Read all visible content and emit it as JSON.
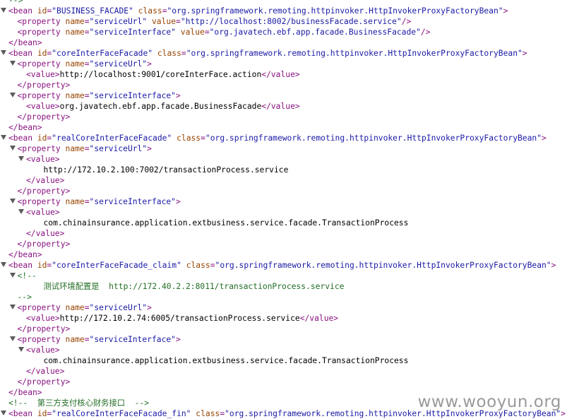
{
  "xml_viewer": {
    "lines": [
      {
        "indent": 0,
        "toggle": false,
        "parts": [
          [
            "cmt",
            "-->"
          ]
        ]
      },
      {
        "indent": 0,
        "toggle": true,
        "parts": [
          [
            "tag",
            "<bean "
          ],
          [
            "attr",
            "id"
          ],
          [
            "tag",
            "="
          ],
          [
            "val",
            "\"BUSINESS_FACADE\""
          ],
          [
            "tag",
            " "
          ],
          [
            "attr",
            "class"
          ],
          [
            "tag",
            "="
          ],
          [
            "val",
            "\"org.springframework.remoting.httpinvoker.HttpInvokerProxyFactoryBean\""
          ],
          [
            "tag",
            ">"
          ]
        ]
      },
      {
        "indent": 1,
        "toggle": false,
        "parts": [
          [
            "tag",
            "<property "
          ],
          [
            "attr",
            "name"
          ],
          [
            "tag",
            "="
          ],
          [
            "val",
            "\"serviceUrl\""
          ],
          [
            "tag",
            " "
          ],
          [
            "attr",
            "value"
          ],
          [
            "tag",
            "="
          ],
          [
            "val",
            "\"http://localhost:8002/businessFacade.service\""
          ],
          [
            "tag",
            "/>"
          ]
        ]
      },
      {
        "indent": 1,
        "toggle": false,
        "parts": [
          [
            "tag",
            "<property "
          ],
          [
            "attr",
            "name"
          ],
          [
            "tag",
            "="
          ],
          [
            "val",
            "\"serviceInterface\""
          ],
          [
            "tag",
            " "
          ],
          [
            "attr",
            "value"
          ],
          [
            "tag",
            "="
          ],
          [
            "val",
            "\"org.javatech.ebf.app.facade.BusinessFacade\""
          ],
          [
            "tag",
            "/>"
          ]
        ]
      },
      {
        "indent": 0,
        "toggle": false,
        "parts": [
          [
            "tag",
            "</bean>"
          ]
        ]
      },
      {
        "indent": 0,
        "toggle": true,
        "parts": [
          [
            "tag",
            "<bean "
          ],
          [
            "attr",
            "id"
          ],
          [
            "tag",
            "="
          ],
          [
            "val",
            "\"coreInterFaceFacade\""
          ],
          [
            "tag",
            " "
          ],
          [
            "attr",
            "class"
          ],
          [
            "tag",
            "="
          ],
          [
            "val",
            "\"org.springframework.remoting.httpinvoker.HttpInvokerProxyFactoryBean\""
          ],
          [
            "tag",
            ">"
          ]
        ]
      },
      {
        "indent": 1,
        "toggle": true,
        "parts": [
          [
            "tag",
            "<property "
          ],
          [
            "attr",
            "name"
          ],
          [
            "tag",
            "="
          ],
          [
            "val",
            "\"serviceUrl\""
          ],
          [
            "tag",
            ">"
          ]
        ]
      },
      {
        "indent": 2,
        "toggle": false,
        "parts": [
          [
            "tag",
            "<value>"
          ],
          [
            "plain",
            "http://localhost:9001/coreInterFace.action"
          ],
          [
            "tag",
            "</value>"
          ]
        ]
      },
      {
        "indent": 1,
        "toggle": false,
        "parts": [
          [
            "tag",
            "</property>"
          ]
        ]
      },
      {
        "indent": 1,
        "toggle": true,
        "parts": [
          [
            "tag",
            "<property "
          ],
          [
            "attr",
            "name"
          ],
          [
            "tag",
            "="
          ],
          [
            "val",
            "\"serviceInterface\""
          ],
          [
            "tag",
            ">"
          ]
        ]
      },
      {
        "indent": 2,
        "toggle": false,
        "parts": [
          [
            "tag",
            "<value>"
          ],
          [
            "plain",
            "org.javatech.ebf.app.facade.BusinessFacade"
          ],
          [
            "tag",
            "</value>"
          ]
        ]
      },
      {
        "indent": 1,
        "toggle": false,
        "parts": [
          [
            "tag",
            "</property>"
          ]
        ]
      },
      {
        "indent": 0,
        "toggle": false,
        "parts": [
          [
            "tag",
            "</bean>"
          ]
        ]
      },
      {
        "indent": 0,
        "toggle": true,
        "parts": [
          [
            "tag",
            "<bean "
          ],
          [
            "attr",
            "id"
          ],
          [
            "tag",
            "="
          ],
          [
            "val",
            "\"realCoreInterFaceFacade\""
          ],
          [
            "tag",
            " "
          ],
          [
            "attr",
            "class"
          ],
          [
            "tag",
            "="
          ],
          [
            "val",
            "\"org.springframework.remoting.httpinvoker.HttpInvokerProxyFactoryBean\""
          ],
          [
            "tag",
            ">"
          ]
        ]
      },
      {
        "indent": 1,
        "toggle": true,
        "parts": [
          [
            "tag",
            "<property "
          ],
          [
            "attr",
            "name"
          ],
          [
            "tag",
            "="
          ],
          [
            "val",
            "\"serviceUrl\""
          ],
          [
            "tag",
            ">"
          ]
        ]
      },
      {
        "indent": 2,
        "toggle": true,
        "parts": [
          [
            "tag",
            "<value>"
          ]
        ]
      },
      {
        "indent": 3,
        "toggle": false,
        "parts": [
          [
            "plain",
            "http://172.10.2.100:7002/transactionProcess.service"
          ]
        ]
      },
      {
        "indent": 2,
        "toggle": false,
        "parts": [
          [
            "tag",
            "</value>"
          ]
        ]
      },
      {
        "indent": 1,
        "toggle": false,
        "parts": [
          [
            "tag",
            "</property>"
          ]
        ]
      },
      {
        "indent": 1,
        "toggle": true,
        "parts": [
          [
            "tag",
            "<property "
          ],
          [
            "attr",
            "name"
          ],
          [
            "tag",
            "="
          ],
          [
            "val",
            "\"serviceInterface\""
          ],
          [
            "tag",
            ">"
          ]
        ]
      },
      {
        "indent": 2,
        "toggle": true,
        "parts": [
          [
            "tag",
            "<value>"
          ]
        ]
      },
      {
        "indent": 3,
        "toggle": false,
        "parts": [
          [
            "plain",
            "com.chinainsurance.application.extbusiness.service.facade.TransactionProcess"
          ]
        ]
      },
      {
        "indent": 2,
        "toggle": false,
        "parts": [
          [
            "tag",
            "</value>"
          ]
        ]
      },
      {
        "indent": 1,
        "toggle": false,
        "parts": [
          [
            "tag",
            "</property>"
          ]
        ]
      },
      {
        "indent": 0,
        "toggle": false,
        "parts": [
          [
            "tag",
            "</bean>"
          ]
        ]
      },
      {
        "indent": 0,
        "toggle": true,
        "parts": [
          [
            "tag",
            "<bean "
          ],
          [
            "attr",
            "id"
          ],
          [
            "tag",
            "="
          ],
          [
            "val",
            "\"coreInterFaceFacade_claim\""
          ],
          [
            "tag",
            " "
          ],
          [
            "attr",
            "class"
          ],
          [
            "tag",
            "="
          ],
          [
            "val",
            "\"org.springframework.remoting.httpinvoker.HttpInvokerProxyFactoryBean\""
          ],
          [
            "tag",
            ">"
          ]
        ]
      },
      {
        "indent": 1,
        "toggle": true,
        "parts": [
          [
            "cmt",
            "<!--"
          ]
        ]
      },
      {
        "indent": 3,
        "toggle": false,
        "parts": [
          [
            "cmt",
            "测试环境配置是  http://172.40.2.2:8011/transactionProcess.service"
          ]
        ]
      },
      {
        "indent": 1,
        "toggle": false,
        "parts": [
          [
            "cmt",
            "-->"
          ]
        ]
      },
      {
        "indent": 1,
        "toggle": true,
        "parts": [
          [
            "tag",
            "<property "
          ],
          [
            "attr",
            "name"
          ],
          [
            "tag",
            "="
          ],
          [
            "val",
            "\"serviceUrl\""
          ],
          [
            "tag",
            ">"
          ]
        ]
      },
      {
        "indent": 2,
        "toggle": false,
        "parts": [
          [
            "tag",
            "<value>"
          ],
          [
            "plain",
            "http://172.10.2.74:6005/transactionProcess.service"
          ],
          [
            "tag",
            "</value>"
          ]
        ]
      },
      {
        "indent": 1,
        "toggle": false,
        "parts": [
          [
            "tag",
            "</property>"
          ]
        ]
      },
      {
        "indent": 1,
        "toggle": true,
        "parts": [
          [
            "tag",
            "<property "
          ],
          [
            "attr",
            "name"
          ],
          [
            "tag",
            "="
          ],
          [
            "val",
            "\"serviceInterface\""
          ],
          [
            "tag",
            ">"
          ]
        ]
      },
      {
        "indent": 2,
        "toggle": true,
        "parts": [
          [
            "tag",
            "<value>"
          ]
        ]
      },
      {
        "indent": 3,
        "toggle": false,
        "parts": [
          [
            "plain",
            "com.chinainsurance.application.extbusiness.service.facade.TransactionProcess"
          ]
        ]
      },
      {
        "indent": 2,
        "toggle": false,
        "parts": [
          [
            "tag",
            "</value>"
          ]
        ]
      },
      {
        "indent": 1,
        "toggle": false,
        "parts": [
          [
            "tag",
            "</property>"
          ]
        ]
      },
      {
        "indent": 0,
        "toggle": false,
        "parts": [
          [
            "tag",
            "</bean>"
          ]
        ]
      },
      {
        "indent": 0,
        "toggle": false,
        "parts": [
          [
            "cmt",
            "<!--  第三方支付核心财务接口  -->"
          ]
        ]
      },
      {
        "indent": 0,
        "toggle": true,
        "parts": [
          [
            "tag",
            "<bean "
          ],
          [
            "attr",
            "id"
          ],
          [
            "tag",
            "="
          ],
          [
            "val",
            "\"realCoreInterFaceFacade_fin\""
          ],
          [
            "tag",
            " "
          ],
          [
            "attr",
            "class"
          ],
          [
            "tag",
            "="
          ],
          [
            "val",
            "\"org.springframework.remoting.httpinvoker.HttpInvokerProxyFactoryBean\""
          ],
          [
            "tag",
            ">"
          ]
        ]
      }
    ]
  },
  "watermark": {
    "text": "www.wooyun.org"
  },
  "colors": {
    "tag": "#881280",
    "attribute": "#994500",
    "value": "#1a1aa6",
    "comment": "#236e25",
    "toggle_icon": "#5a5a5a"
  },
  "icons": {
    "toggle": "triangle-down-icon"
  }
}
